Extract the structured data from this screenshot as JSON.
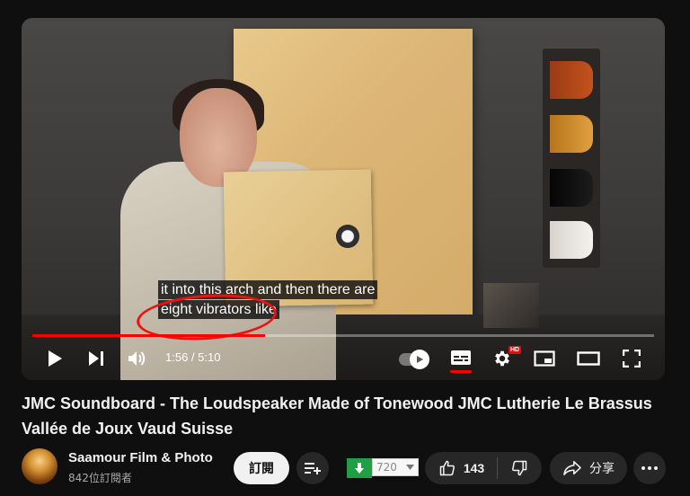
{
  "player": {
    "captions": [
      "it into this arch and then there are",
      "eight vibrators like"
    ],
    "current_time": "1:56",
    "duration": "5:10",
    "time_display": "1:56 / 5:10",
    "progress_fraction": 0.374,
    "settings_badge": "HD"
  },
  "video": {
    "title": "JMC Soundboard - The Loudspeaker Made of Tonewood JMC Lutherie Le Brassus Vallée de Joux Vaud Suisse"
  },
  "channel": {
    "name": "Saamour Film & Photo",
    "subscribers": "842位訂閱者"
  },
  "actions": {
    "subscribe_label": "訂閱",
    "quality_value": "720",
    "like_count": "143",
    "share_label": "分享"
  },
  "icons": {
    "play": "play-icon",
    "next": "next-icon",
    "volume": "volume-icon",
    "autoplay": "autoplay-toggle-icon",
    "subtitles": "subtitles-icon",
    "settings": "gear-icon",
    "miniplayer": "miniplayer-icon",
    "theater": "theater-icon",
    "fullscreen": "fullscreen-icon",
    "playlist_add": "playlist-add-icon",
    "download": "download-arrow-icon",
    "like": "thumbs-up-icon",
    "dislike": "thumbs-down-icon",
    "share": "share-icon",
    "more": "more-icon"
  },
  "colors": {
    "accent": "#ff0000",
    "background": "#0f0f0f",
    "extension_green": "#1fa045"
  }
}
